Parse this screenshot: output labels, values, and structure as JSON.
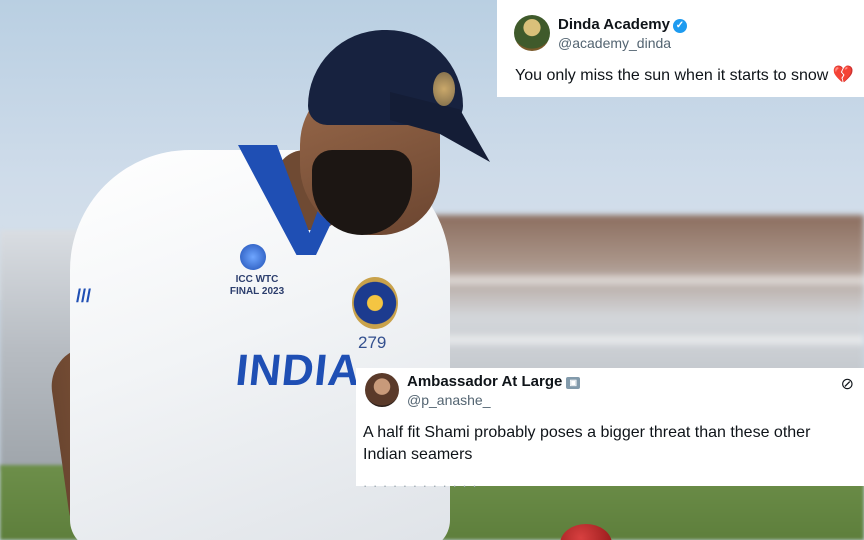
{
  "tweets": [
    {
      "name": "Dinda Academy",
      "handle": "@academy_dinda",
      "text": "You only miss the sun when it starts to snow",
      "emoji": "💔"
    },
    {
      "name": "Ambassador At Large",
      "handle": "@p_anashe_",
      "text": "A half fit Shami probably poses a bigger threat than these other Indian seamers"
    }
  ],
  "jersey": {
    "tournament": "ICC WTC FINAL 2023",
    "number": "279",
    "country": "INDIA"
  }
}
